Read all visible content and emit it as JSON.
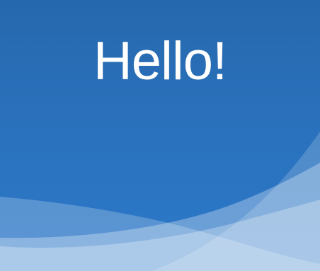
{
  "screen": {
    "greeting": "Hello!"
  },
  "colors": {
    "background_top": "#2668ad",
    "background_bottom": "#2c79ca",
    "text": "#ffffff",
    "wave_light": "#cfe0f5"
  }
}
